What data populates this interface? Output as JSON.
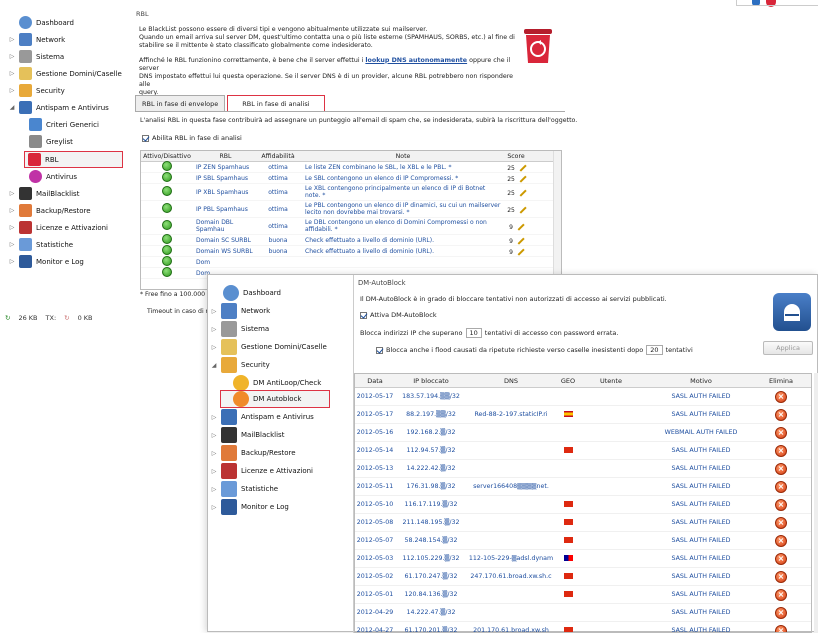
{
  "window1": {
    "section_label": "RBL",
    "intro_p1": "Le BlackList possono essere di diversi tipi e vengono abitualmente utilizzate sui mailserver.",
    "intro_p2": "Quando un email arriva sul server DM, quest'ultimo contatta una o più liste esterne (SPAMHAUS, SORBS, etc.) al fine di",
    "intro_p3": "stabilire se  il mittente è stato classificato globalmente come indesiderato.",
    "intro_p4a": "Affinché le RBL funzionino correttamente, è bene che il server effettui i ",
    "intro_link": "lookup DNS autonomamente",
    "intro_p4b": " oppure che il server",
    "intro_p5": "DNS impostato effettui lui questa operazione. Se il server DNS è di un provider, alcune RBL potrebbero non rispondere alle",
    "intro_p6": "query.",
    "tabs": [
      "RBL in fase di envelope",
      "RBL in fase di analisi"
    ],
    "analysis_desc": "L'analisi RBL in questa fase contribuirà ad assegnare un punteggio all'email di spam che, se indesiderata, subirà la riscrittura dell'oggetto.",
    "enable_label": "Abilita RBL in fase di analisi",
    "table_headers": [
      "Attivo/Disattivo",
      "RBL",
      "Affidabilità",
      "Note",
      "Score"
    ],
    "rows": [
      {
        "rbl": "IP ZEN Spamhaus",
        "aff": "ottima",
        "note": "Le liste ZEN combinano le SBL, le XBL e le PBL. *",
        "score": "25"
      },
      {
        "rbl": "IP SBL Spamhaus",
        "aff": "ottima",
        "note": "Le SBL contengono un elenco di IP Compromessi. *",
        "score": "25"
      },
      {
        "rbl": "IP XBL Spamhaus",
        "aff": "ottima",
        "note": "Le XBL contengono principalmente un elenco di IP di Botnet note. *",
        "score": "25"
      },
      {
        "rbl": "IP PBL Spamhaus",
        "aff": "ottima",
        "note": "Le PBL contengono un elenco di IP dinamici, su cui un mailserver lecito non dovrebbe mai trovarsi. *",
        "score": "25"
      },
      {
        "rbl": "Domain DBL Spamhau",
        "aff": "ottima",
        "note": "Le DBL contengono un elenco di Domini Compromessi o non affidabili. *",
        "score": "9"
      },
      {
        "rbl": "Domain SC SURBL",
        "aff": "buona",
        "note": "Check effettuato a livello di dominio (URL).",
        "score": "9"
      },
      {
        "rbl": "Domain WS SURBL",
        "aff": "buona",
        "note": "Check effettuato a livello di dominio (URL).",
        "score": "9"
      },
      {
        "rbl": "Dom",
        "aff": "",
        "note": "",
        "score": ""
      },
      {
        "rbl": "Dom",
        "aff": "",
        "note": "",
        "score": ""
      }
    ],
    "footnote": "* Free fino a 100.000 qu",
    "timeout": "Timeout in caso di m",
    "status_kb": "26 KB",
    "status_tx": "TX:",
    "status_kb2": "0 KB",
    "status_zero": "0",
    "nav": [
      "Dashboard",
      "Network",
      "Sistema",
      "Gestione Domini/Caselle",
      "Security",
      "Antispam e Antivirus",
      "Criteri Generici",
      "Greylist",
      "RBL",
      "Antivirus",
      "MailBlacklist",
      "Backup/Restore",
      "Licenze e Attivazioni",
      "Statistiche",
      "Monitor e Log"
    ]
  },
  "window2": {
    "title": "DM-AutoBlock",
    "desc": "Il DM-AutoBlock è in grado di bloccare tentativi non autorizzati di accesso ai servizi pubblicati.",
    "enable_label": "Attiva DM-AutoBlock",
    "block_pre": "Blocca indirizzi IP che superano",
    "block_val": "10",
    "block_post": "tentativi di accesso con password errata.",
    "flood_pre": "Blocca anche i flood causati da ripetute richieste verso caselle inesistenti dopo",
    "flood_val": "20",
    "flood_post": "tentativi",
    "apply_label": "Applica",
    "nav": [
      "Dashboard",
      "Network",
      "Sistema",
      "Gestione Domini/Caselle",
      "Security",
      "DM AntiLoop/Check",
      "DM Autoblock",
      "Antispam e Antivirus",
      "MailBlacklist",
      "Backup/Restore",
      "Licenze e Attivazioni",
      "Statistiche",
      "Monitor e Log"
    ],
    "headers": [
      "Data",
      "IP bloccato",
      "DNS",
      "GEO",
      "Utente",
      "Motivo",
      "Elimina"
    ],
    "rows": [
      {
        "date": "2012-05-17",
        "ip": "183.57.194.▒▒/32",
        "dns": "",
        "geo": "",
        "reason": "SASL AUTH FAILED"
      },
      {
        "date": "2012-05-17",
        "ip": "88.2.197.▒▒/32",
        "dns": "Red-88-2-197.staticIP.ri",
        "geo": "es",
        "reason": "SASL AUTH FAILED"
      },
      {
        "date": "2012-05-16",
        "ip": "192.168.2.▒/32",
        "dns": "",
        "geo": "",
        "reason": "WEBMAIL AUTH FAILED"
      },
      {
        "date": "2012-05-14",
        "ip": "112.94.57.▒/32",
        "dns": "",
        "geo": "cn",
        "reason": "SASL AUTH FAILED"
      },
      {
        "date": "2012-05-13",
        "ip": "14.222.42.▒/32",
        "dns": "",
        "geo": "",
        "reason": "SASL AUTH FAILED"
      },
      {
        "date": "2012-05-11",
        "ip": "176.31.98.▒/32",
        "dns": "server166408▒▒▒▒net.",
        "geo": "",
        "reason": "SASL AUTH FAILED"
      },
      {
        "date": "2012-05-10",
        "ip": "116.17.119.▒/32",
        "dns": "",
        "geo": "cn",
        "reason": "SASL AUTH FAILED"
      },
      {
        "date": "2012-05-08",
        "ip": "211.148.195.▒/32",
        "dns": "",
        "geo": "cn",
        "reason": "SASL AUTH FAILED"
      },
      {
        "date": "2012-05-07",
        "ip": "58.248.154.▒/32",
        "dns": "",
        "geo": "cn",
        "reason": "SASL AUTH FAILED"
      },
      {
        "date": "2012-05-03",
        "ip": "112.105.229.▒/32",
        "dns": "112-105-229-▒adsl.dynam",
        "geo": "tw",
        "reason": "SASL AUTH FAILED"
      },
      {
        "date": "2012-05-02",
        "ip": "61.170.247.▒/32",
        "dns": "247.170.61.broad.xw.sh.c",
        "geo": "cn",
        "reason": "SASL AUTH FAILED"
      },
      {
        "date": "2012-05-01",
        "ip": "120.84.136.▒/32",
        "dns": "",
        "geo": "cn",
        "reason": "SASL AUTH FAILED"
      },
      {
        "date": "2012-04-29",
        "ip": "14.222.47.▒/32",
        "dns": "",
        "geo": "",
        "reason": "SASL AUTH FAILED"
      },
      {
        "date": "2012-04-27",
        "ip": "61.170.201.▒/32",
        "dns": "201.170.61.broad.xw.sh",
        "geo": "cn",
        "reason": "SASL AUTH FAILED"
      }
    ]
  },
  "colors": {
    "accent_red": "#d9263a",
    "link_blue": "#1f4fa0",
    "green": "#2f9a1e"
  }
}
